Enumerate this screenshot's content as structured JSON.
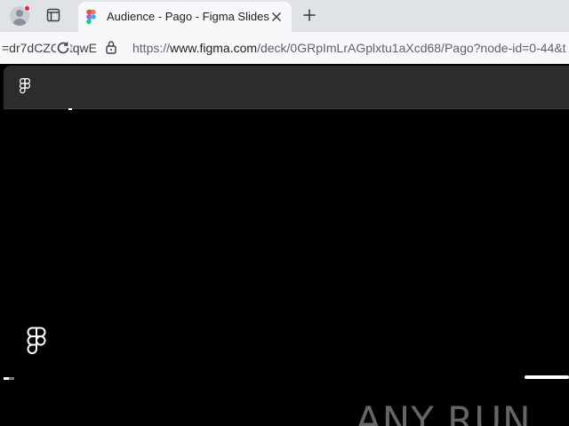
{
  "browser": {
    "tab": {
      "title": "Audience - Pago - Figma Slides"
    },
    "address": {
      "left_fragment": "=dr7dCZC  stqwE",
      "url_prefix": "https://",
      "url_host": "www.figma.com",
      "url_path": "/deck/0GRpImLrAGplxtu1aXcd68/Pago?node-id=0-44&t"
    }
  },
  "icons": {
    "profile": "avatar-icon",
    "tab_actions": "tab-actions-icon",
    "favicon": "figma-favicon",
    "close": "close-icon",
    "new_tab": "plus-icon",
    "reload": "reload-icon",
    "lock": "lock-icon",
    "figma_logo": "figma-logo-icon"
  },
  "watermark": {
    "text": "ANY RUN"
  },
  "colors": {
    "figma_red": "#f24e1e",
    "figma_orange": "#ff7262",
    "figma_purple": "#a259ff",
    "figma_blue": "#1abcfe",
    "figma_green": "#0acf83",
    "notification": "#e3262d"
  }
}
